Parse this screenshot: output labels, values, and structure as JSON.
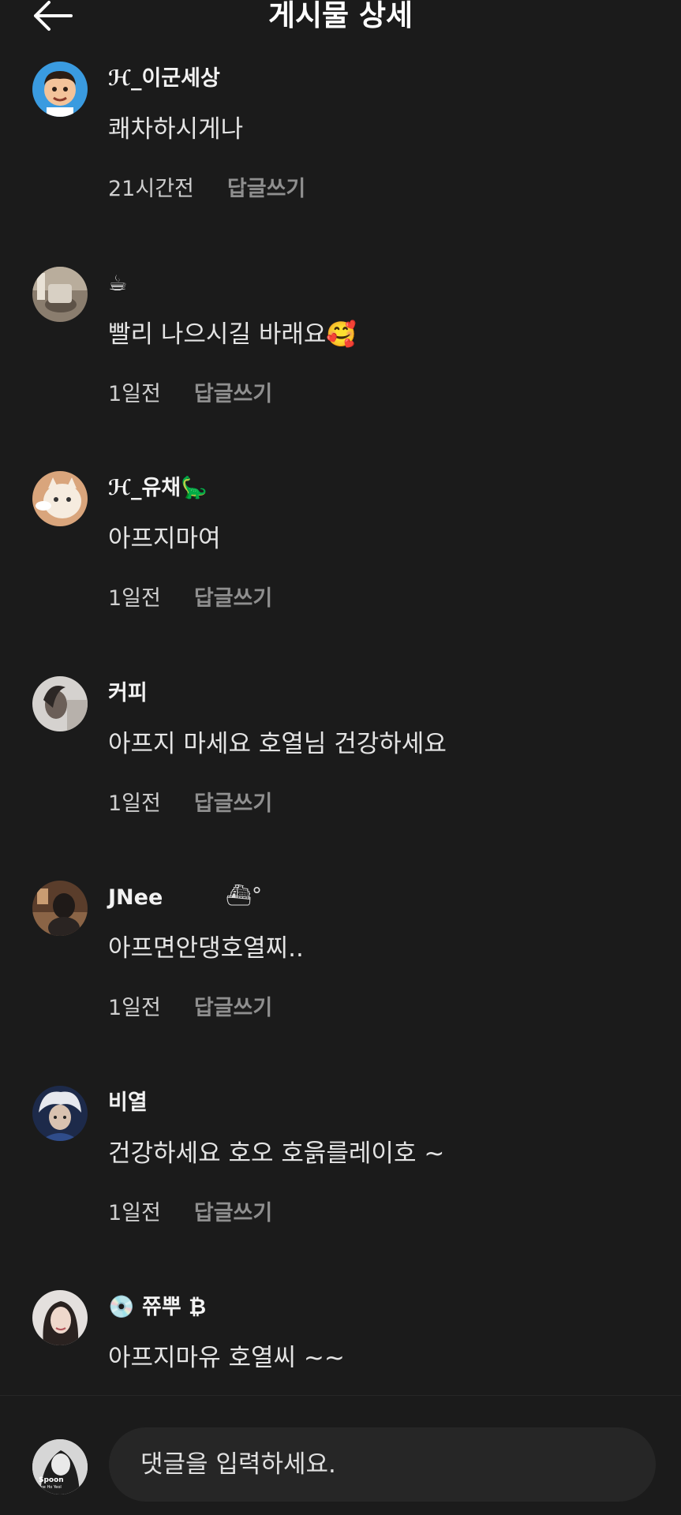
{
  "header": {
    "title": "게시물 상세",
    "back_icon": "arrow-left-icon"
  },
  "comments": [
    {
      "nickname": "ℋ_이군세상",
      "text": "쾌차하시게나",
      "time": "21시간전",
      "reply_label": "답글쓰기",
      "avatar": "cartoon-man-avatar"
    },
    {
      "nickname": "☕",
      "text": "빨리 나으시길  바래요🥰",
      "time": "1일전",
      "reply_label": "답글쓰기",
      "avatar": "cafe-photo-avatar"
    },
    {
      "nickname": "ℋ_유채🦕",
      "text": "아프지마여",
      "time": "1일전",
      "reply_label": "답글쓰기",
      "avatar": "cat-photo-avatar"
    },
    {
      "nickname": "커피",
      "text": "아프지 마세요 호열님 건강하세요",
      "time": "1일전",
      "reply_label": "답글쓰기",
      "avatar": "person-photo-avatar"
    },
    {
      "nickname": "JNee",
      "nickname_extra": "⛴°",
      "text": "아프면안댕호열찌..",
      "time": "1일전",
      "reply_label": "답글쓰기",
      "avatar": "person-photo-avatar"
    },
    {
      "nickname": "비열",
      "text": "건강하세요 호오 호읅를레이호 ~",
      "time": "1일전",
      "reply_label": "답글쓰기",
      "avatar": "anime-character-avatar"
    },
    {
      "nickname": "💿 쮸뿌 ₿",
      "text": "아프지마유 호열씨 ~~",
      "avatar": "woman-photo-avatar"
    }
  ],
  "composer": {
    "placeholder": "댓글을 입력하세요.",
    "my_avatar_text": "Spoon",
    "my_avatar_name": "Lee Ho Yeol"
  },
  "colors": {
    "background": "#1b1b1b",
    "input_background": "#262626",
    "reply_text": "#8f8f8f"
  }
}
